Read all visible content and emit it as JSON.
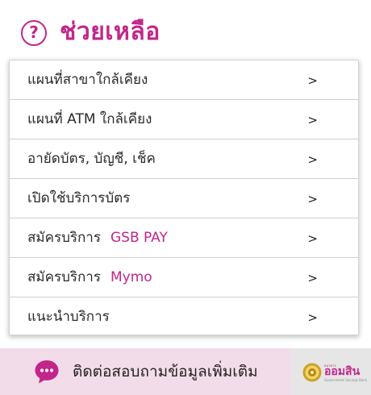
{
  "header": {
    "icon": "help-circle-icon",
    "icon_glyph": "?",
    "title": "ช่วยเหลือ",
    "accent_color": "#c2268a"
  },
  "menu": {
    "items": [
      {
        "label": "แผนที่สาขาใกล้เคียง",
        "highlight": "",
        "arrow": ">"
      },
      {
        "label": "แผนที่ ATM ใกล้เคียง",
        "highlight": "",
        "arrow": ">"
      },
      {
        "label": "อายัดบัตร, บัญชี, เช็ค",
        "highlight": "",
        "arrow": ">"
      },
      {
        "label": "เปิดใช้บริการบัตร",
        "highlight": "",
        "arrow": ">"
      },
      {
        "label": "สมัครบริการ",
        "highlight": "GSB PAY",
        "arrow": ">"
      },
      {
        "label": "สมัครบริการ",
        "highlight": "Mymo",
        "arrow": ">"
      },
      {
        "label": "แนะนำบริการ",
        "highlight": "",
        "arrow": ">"
      }
    ]
  },
  "footer": {
    "contact_icon": "chat-bubble-icon",
    "contact_label": "ติดต่อสอบถามข้อมูลเพิ่มเติม",
    "logo": {
      "small_text": "ธนาคาร",
      "text": "ออมสิน",
      "sub_text": "Government Savings Bank"
    }
  }
}
